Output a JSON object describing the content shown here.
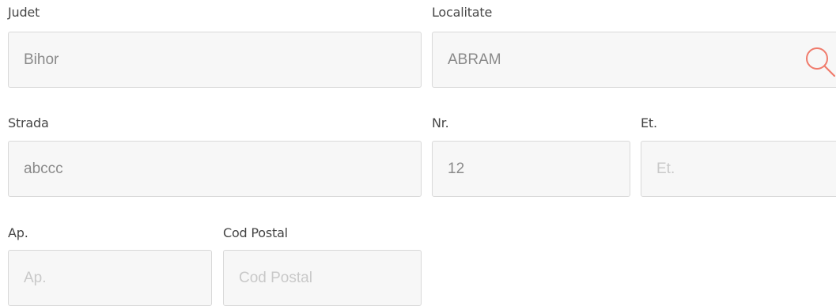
{
  "form": {
    "judet": {
      "label": "Judet",
      "value": "Bihor",
      "placeholder": ""
    },
    "localitate": {
      "label": "Localitate",
      "value": "ABRAM",
      "placeholder": ""
    },
    "strada": {
      "label": "Strada",
      "value": "abccc",
      "placeholder": ""
    },
    "nr": {
      "label": "Nr.",
      "value": "12",
      "placeholder": ""
    },
    "et": {
      "label": "Et.",
      "value": "",
      "placeholder": "Et."
    },
    "ap": {
      "label": "Ap.",
      "value": "",
      "placeholder": "Ap."
    },
    "cod_postal": {
      "label": "Cod Postal",
      "value": "",
      "placeholder": "Cod Postal"
    }
  },
  "icons": {
    "search": "search-icon"
  },
  "colors": {
    "label_text": "#454545",
    "field_bg": "#f7f7f7",
    "field_border": "#d9d9d9",
    "value_text": "#8a8a8a",
    "placeholder_text": "#c9c9c9",
    "search_icon": "#f07b6c"
  }
}
